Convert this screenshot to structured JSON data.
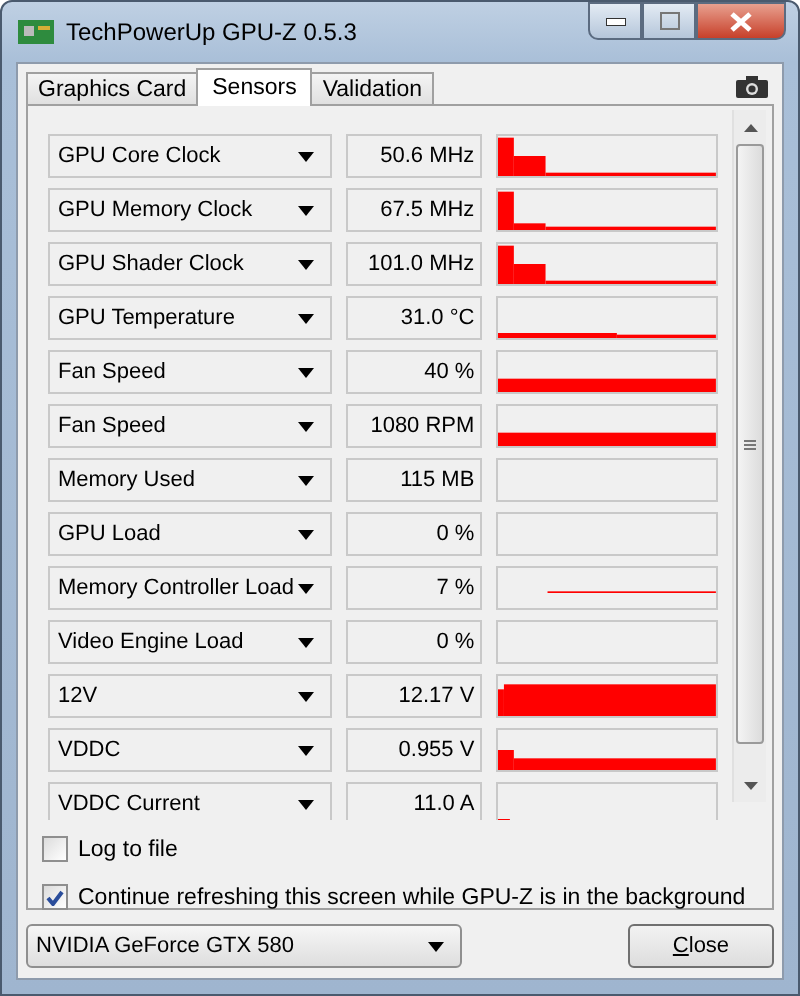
{
  "window": {
    "title": "TechPowerUp GPU-Z 0.5.3"
  },
  "tabs": [
    {
      "label": "Graphics Card",
      "selected": false
    },
    {
      "label": "Sensors",
      "selected": true
    },
    {
      "label": "Validation",
      "selected": false
    }
  ],
  "sensors": [
    {
      "name": "GPU Core Clock",
      "value": "50.6 MHz",
      "kind": "clock-step"
    },
    {
      "name": "GPU Memory Clock",
      "value": "67.5 MHz",
      "kind": "clock-spike"
    },
    {
      "name": "GPU Shader Clock",
      "value": "101.0 MHz",
      "kind": "clock-step"
    },
    {
      "name": "GPU Temperature",
      "value": "31.0 °C",
      "kind": "low-line"
    },
    {
      "name": "Fan Speed",
      "value": "40 %",
      "kind": "low-bar"
    },
    {
      "name": "Fan Speed",
      "value": "1080 RPM",
      "kind": "low-bar"
    },
    {
      "name": "Memory Used",
      "value": "115 MB",
      "kind": "none"
    },
    {
      "name": "GPU Load",
      "value": "0 %",
      "kind": "none"
    },
    {
      "name": "Memory Controller Load",
      "value": "7 %",
      "kind": "mid-line"
    },
    {
      "name": "Video Engine Load",
      "value": "0 %",
      "kind": "none"
    },
    {
      "name": "12V",
      "value": "12.17 V",
      "kind": "high-fill"
    },
    {
      "name": "VDDC",
      "value": "0.955 V",
      "kind": "bump-bar"
    },
    {
      "name": "VDDC Current",
      "value": "11.0 A",
      "kind": "blip"
    }
  ],
  "options": [
    {
      "label": "Log to file",
      "checked": false
    },
    {
      "label": "Continue refreshing this screen while GPU-Z is in the background",
      "checked": true
    }
  ],
  "device_select": {
    "value": "NVIDIA GeForce GTX 580"
  },
  "close_button": {
    "label": "Close"
  }
}
